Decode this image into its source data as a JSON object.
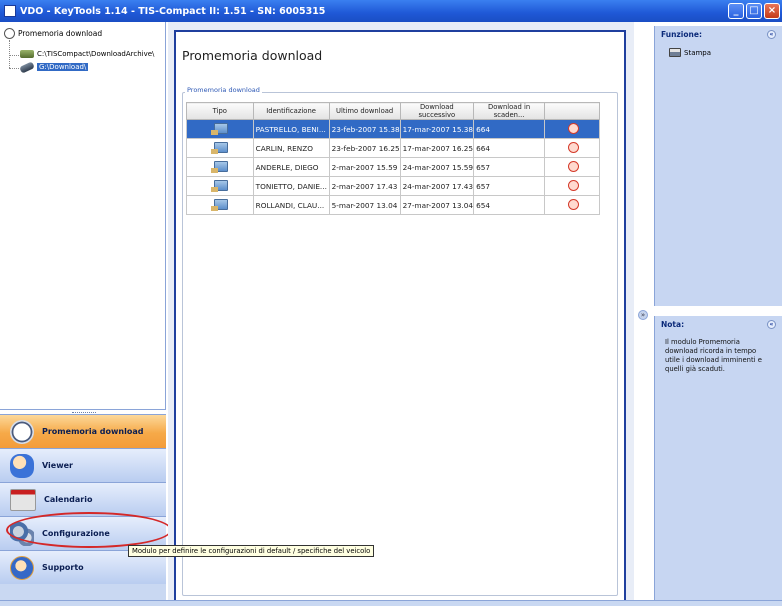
{
  "window": {
    "title": "VDO - KeyTools 1.14 - TIS-Compact II: 1.51 - SN: 6005315",
    "min_glyph": "_",
    "max_glyph": "□",
    "close_glyph": "×"
  },
  "tree": {
    "root": "Promemoria download",
    "items": [
      {
        "label": "C:\\TISCompact\\DownloadArchive\\"
      },
      {
        "label": "G:\\Download\\"
      }
    ]
  },
  "nav": {
    "items": [
      {
        "label": "Promemoria download",
        "icon": "clock-icon"
      },
      {
        "label": "Viewer",
        "icon": "viewer-icon"
      },
      {
        "label": "Calendario",
        "icon": "calendar-icon"
      },
      {
        "label": "Configurazione",
        "icon": "gear-icon"
      },
      {
        "label": "Supporto",
        "icon": "support-icon"
      }
    ],
    "tooltip": "Modulo per definire le configurazioni di default / specifiche del veicolo"
  },
  "main": {
    "title": "Promemoria download",
    "group_caption": "Promemoria download",
    "columns": [
      "Tipo",
      "Identificazione",
      "Ultimo download",
      "Download successivo",
      "Download in scaden...",
      ""
    ],
    "rows": [
      {
        "ident": "PASTRELLO, BENI...",
        "last": "23-feb-2007 15.38",
        "next": "17-mar-2007 15.38",
        "due": "664",
        "selected": true
      },
      {
        "ident": "CARLIN, RENZO",
        "last": "23-feb-2007 16.25",
        "next": "17-mar-2007 16.25",
        "due": "664",
        "selected": false
      },
      {
        "ident": "ANDERLE, DIEGO",
        "last": "2-mar-2007 15.59",
        "next": "24-mar-2007 15.59",
        "due": "657",
        "selected": false
      },
      {
        "ident": "TONIETTO, DANIE...",
        "last": "2-mar-2007 17.43",
        "next": "24-mar-2007 17.43",
        "due": "657",
        "selected": false
      },
      {
        "ident": "ROLLANDI, CLAU...",
        "last": "5-mar-2007 13.04",
        "next": "27-mar-2007 13.04",
        "due": "654",
        "selected": false
      }
    ]
  },
  "right": {
    "funzione_title": "Funzione:",
    "funzione_items": [
      "Stampa"
    ],
    "nota_title": "Nota:",
    "nota_text": "Il modulo Promemoria download ricorda in tempo utile i download imminenti e quelli già scaduti.",
    "chevron_glyph": "«"
  },
  "colors": {
    "accent": "#316ac5",
    "active_nav": "#f6a948",
    "highlight": "#d42828"
  }
}
